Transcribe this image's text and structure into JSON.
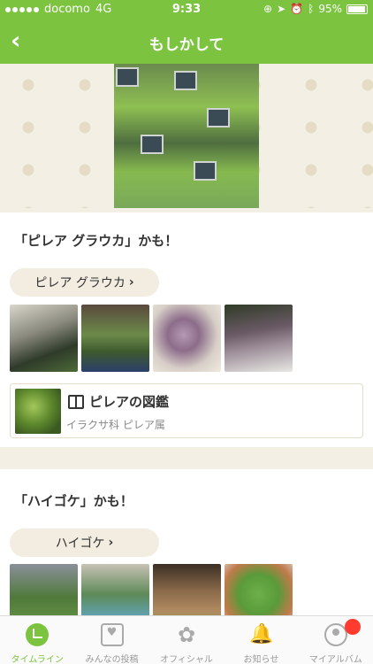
{
  "status_bar": {
    "carrier": "docomo",
    "network": "4G",
    "time": "9:33",
    "battery": "95%"
  },
  "nav": {
    "title": "もしかして",
    "back_icon": "chevron-left-icon"
  },
  "results": [
    {
      "title": "「ピレア グラウカ」かも！",
      "chip_label": "ピレア グラウカ",
      "zukan": {
        "title": "ピレアの図鑑",
        "subtitle": "イラクサ科 ピレア属"
      }
    },
    {
      "title": "「ハイゴケ」かも！",
      "chip_label": "ハイゴケ"
    }
  ],
  "tabs": [
    {
      "label": "タイムライン",
      "icon": "home-icon",
      "active": true
    },
    {
      "label": "みんなの投稿",
      "icon": "post-icon"
    },
    {
      "label": "オフィシャル",
      "icon": "clover-icon"
    },
    {
      "label": "お知らせ",
      "icon": "bell-icon"
    },
    {
      "label": "マイアルバム",
      "icon": "album-icon"
    }
  ],
  "colors": {
    "accent": "#7cc33f",
    "badge": "#ff3b30"
  }
}
